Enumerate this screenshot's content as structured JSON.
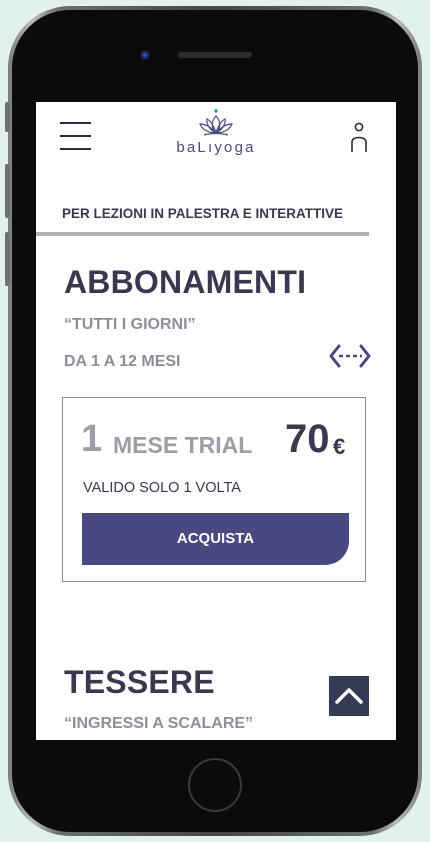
{
  "header": {
    "logo_text": "baLıyoga"
  },
  "tagline": "PER LEZIONI IN PALESTRA E INTERATTIVE",
  "abbonamenti": {
    "title": "ABBONAMENTI",
    "subtitle": "“TUTTI I GIORNI”",
    "duration": "DA 1 A 12 MESI"
  },
  "plan_card": {
    "number": "1",
    "name": "MESE TRIAL",
    "price": "70",
    "currency": "€",
    "note": "VALIDO SOLO 1 VOLTA",
    "button_label": "ACQUISTA"
  },
  "tessere": {
    "title": "TESSERE",
    "subtitle": "“INGRESSI A SCALARE”"
  },
  "icons": {
    "menu": "hamburger-icon",
    "user": "user-icon",
    "swipe": "swipe-horizontal-icon",
    "scroll_top": "chevron-up-icon",
    "logo": "lotus-icon"
  },
  "colors": {
    "brand": "#4a4880",
    "text_dark": "#38384e",
    "text_muted": "#8e8e9a",
    "background": "#e3f1ee"
  }
}
